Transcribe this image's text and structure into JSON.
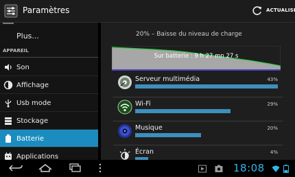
{
  "actionbar": {
    "title": "Paramètres",
    "app_icon": "settings-sliders-icon",
    "refresh_icon": "refresh-icon",
    "refresh_label": "ACTUALISER"
  },
  "sidebar": {
    "more_label": "Plus...",
    "section_header": "APPAREIL",
    "items": [
      {
        "label": "Son",
        "icon": "speaker-icon"
      },
      {
        "label": "Affichage",
        "icon": "brightness-icon"
      },
      {
        "label": "Usb mode",
        "icon": "usb-icon"
      },
      {
        "label": "Stockage",
        "icon": "storage-icon"
      },
      {
        "label": "Batterie",
        "icon": "battery-icon",
        "selected": true
      },
      {
        "label": "Applications",
        "icon": "apps-icon"
      }
    ]
  },
  "battery": {
    "title": "20% – Baisse du niveau de charge",
    "graph_label": "Sur batterie : 9 h 27 mn 27 s",
    "graph_fill_color": "#a7a7a7",
    "graph_line_color": "#2ecc40",
    "graph_axis_color": "#4b44c6",
    "usage": [
      {
        "name": "Serveur multimédia",
        "percent": "43%",
        "fraction": 1.0,
        "icon": "media-server-icon"
      },
      {
        "name": "Wi-Fi",
        "percent": "29%",
        "fraction": 0.67,
        "icon": "wifi-icon"
      },
      {
        "name": "Musique",
        "percent": "20%",
        "fraction": 0.46,
        "icon": "music-icon"
      },
      {
        "name": "Écran",
        "percent": "4%",
        "fraction": 0.09,
        "icon": "screen-brightness-icon"
      }
    ],
    "bar_color": "#3d8fbc"
  },
  "system_bar": {
    "time": "18:08",
    "accent_color": "#33b5e5",
    "back_icon": "back-icon",
    "home_icon": "home-icon",
    "recents_icon": "recents-icon",
    "menu_icon": "menu-dots-icon"
  }
}
